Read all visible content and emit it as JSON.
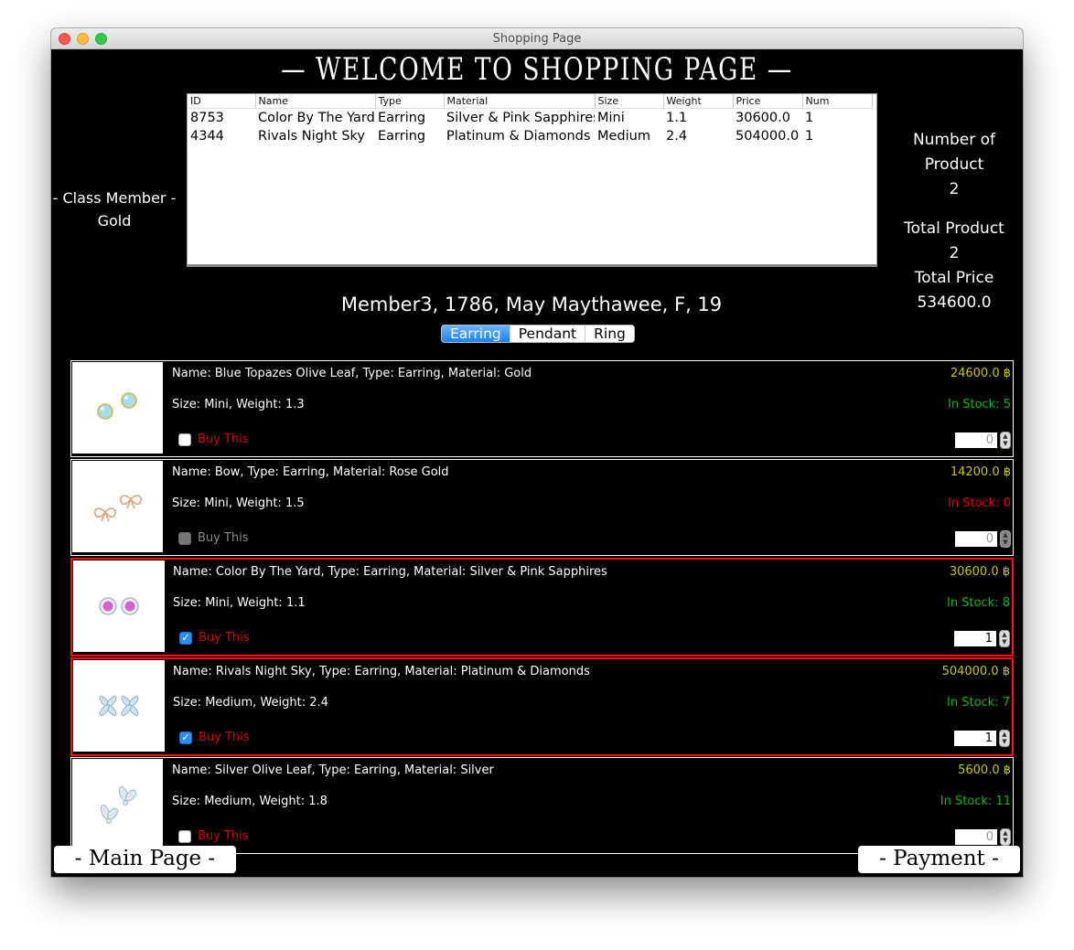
{
  "window": {
    "title": "Shopping Page"
  },
  "header": {
    "title": "— WELCOME TO SHOPPING PAGE —"
  },
  "member_class": {
    "label": "- Class Member -",
    "value": "Gold"
  },
  "cart_table": {
    "columns": [
      "ID",
      "Name",
      "Type",
      "Material",
      "Size",
      "Weight",
      "Price",
      "Num"
    ],
    "rows": [
      [
        "8753",
        "Color By The Yard",
        "Earring",
        "Silver & Pink Sapphires",
        "Mini",
        "1.1",
        "30600.0",
        "1"
      ],
      [
        "4344",
        "Rivals Night Sky",
        "Earring",
        "Platinum & Diamonds",
        "Medium",
        "2.4",
        "504000.0",
        "1"
      ]
    ]
  },
  "summary": {
    "number_of_product_label": "Number of Product",
    "number_of_product": "2",
    "total_product_label": "Total Product",
    "total_product": "2",
    "total_price_label": "Total Price",
    "total_price": "534600.0"
  },
  "member_info": "Member3, 1786, May Maythawee, F, 19",
  "tabs": [
    {
      "label": "Earring",
      "active": true
    },
    {
      "label": "Pendant",
      "active": false
    },
    {
      "label": "Ring",
      "active": false
    }
  ],
  "products": [
    {
      "line1": "Name: Blue Topazes Olive Leaf, Type: Earring, Material: Gold",
      "line2": "Size: Mini, Weight: 1.3",
      "price": "24600.0 ฿",
      "stock": "In Stock: 5",
      "in_stock": true,
      "buy_label": "Buy This",
      "checked": false,
      "disabled": false,
      "quantity": "0",
      "image": "blue-topaz-earrings"
    },
    {
      "line1": "Name: Bow, Type: Earring, Material: Rose Gold",
      "line2": "Size: Mini, Weight: 1.5",
      "price": "14200.0 ฿",
      "stock": "In Stock: 0",
      "in_stock": false,
      "buy_label": "Buy This",
      "checked": false,
      "disabled": true,
      "quantity": "0",
      "image": "bow-earrings"
    },
    {
      "line1": "Name: Color By The Yard, Type: Earring, Material: Silver & Pink Sapphires",
      "line2": "Size: Mini, Weight: 1.1",
      "price": "30600.0 ฿",
      "stock": "In Stock: 8",
      "in_stock": true,
      "buy_label": "Buy This",
      "checked": true,
      "disabled": false,
      "quantity": "1",
      "image": "pink-sapphire-earrings"
    },
    {
      "line1": "Name: Rivals Night Sky, Type: Earring, Material: Platinum & Diamonds",
      "line2": "Size: Medium, Weight: 2.4",
      "price": "504000.0 ฿",
      "stock": "In Stock: 7",
      "in_stock": true,
      "buy_label": "Buy This",
      "checked": true,
      "disabled": false,
      "quantity": "1",
      "image": "diamond-flower-earrings"
    },
    {
      "line1": "Name: Silver Olive Leaf, Type: Earring, Material: Silver",
      "line2": "Size: Medium, Weight: 1.8",
      "price": "5600.0 ฿",
      "stock": "In Stock: 11",
      "in_stock": true,
      "buy_label": "Buy This",
      "checked": false,
      "disabled": false,
      "quantity": "0",
      "image": "silver-leaf-earrings"
    }
  ],
  "buttons": {
    "main_page": "- Main Page -",
    "payment": "- Payment -"
  },
  "colors": {
    "background": "#000000",
    "price": "#c8c217",
    "in_stock": "#13b413",
    "out_of_stock": "#e00000",
    "buy_label": "#d10000",
    "selected_border": "#ff1010",
    "tab_active": "#1a82fb"
  }
}
